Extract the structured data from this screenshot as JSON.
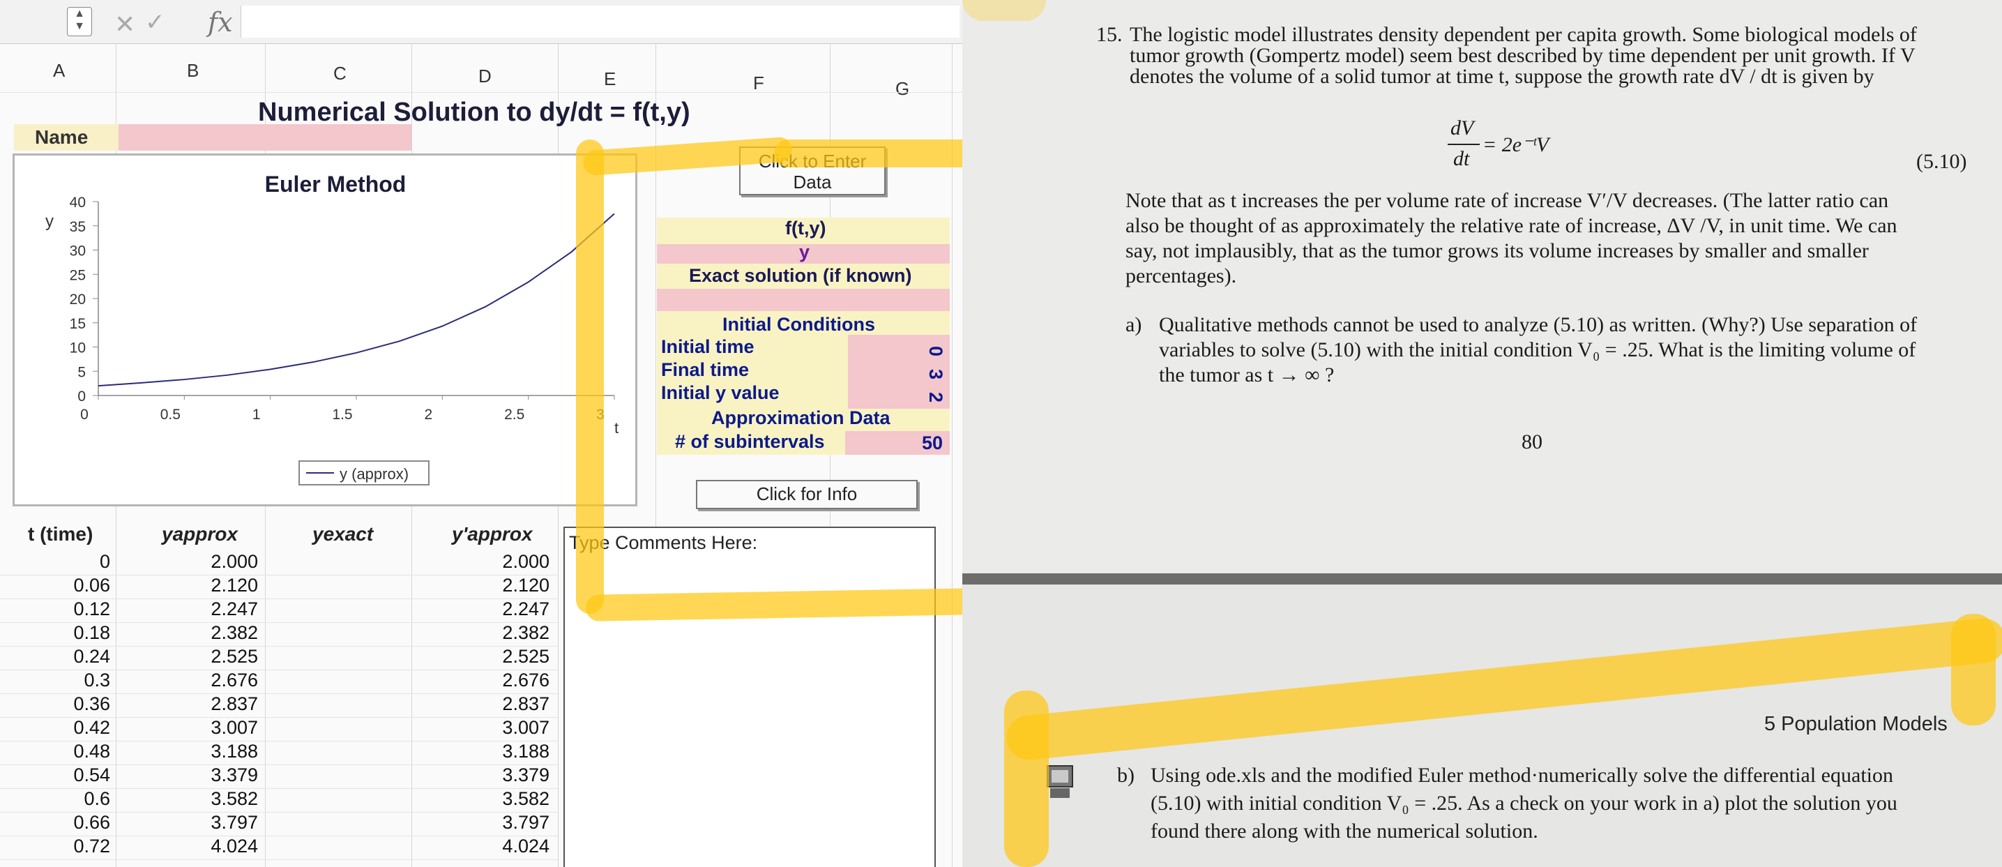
{
  "formula_bar": {
    "cancel_glyph": "✕",
    "enter_glyph": "✓",
    "fx_label": "fx"
  },
  "columns": [
    "A",
    "B",
    "C",
    "D",
    "E",
    "F",
    "G"
  ],
  "sheet": {
    "title": "Numerical Solution to  dy/dt = f(t,y)",
    "name_label": "Name",
    "enter_data_button": "Click to Enter Data",
    "ft_label": "f(t,y)",
    "y_label": "y",
    "exact_label": "Exact solution (if known)",
    "init_conditions_label": "Initial Conditions",
    "initial_time_label": "Initial time",
    "final_time_label": "Final time",
    "initial_y_label": "Initial y value",
    "approx_data_label": "Approximation Data",
    "subintervals_label": "# of subintervals",
    "initial_time_value": "0",
    "final_time_value": "3",
    "initial_y_value": "2",
    "subintervals_value": "50",
    "info_button": "Click for Info",
    "comments_label": "Type Comments Here:"
  },
  "chart_data": {
    "type": "line",
    "title": "Euler Method",
    "ylabel": "y",
    "xlabel": "t",
    "xlim": [
      0,
      3
    ],
    "ylim": [
      0,
      40
    ],
    "x_ticks": [
      "0",
      "0.5",
      "1",
      "1.5",
      "2",
      "2.5",
      "3"
    ],
    "y_ticks": [
      "0",
      "5",
      "10",
      "15",
      "20",
      "25",
      "30",
      "35",
      "40"
    ],
    "legend": "y (approx)",
    "series": [
      {
        "name": "y (approx)",
        "color": "#2b2b7a",
        "x": [
          0,
          0.25,
          0.5,
          0.75,
          1.0,
          1.25,
          1.5,
          1.75,
          2.0,
          2.25,
          2.5,
          2.75,
          3.0
        ],
        "y": [
          2.0,
          2.6,
          3.3,
          4.2,
          5.4,
          6.9,
          8.8,
          11.2,
          14.3,
          18.3,
          23.4,
          29.6,
          37.5
        ]
      }
    ]
  },
  "table": {
    "headers": {
      "t": "t (time)",
      "yapprox": "yapprox",
      "yexact": "yexact",
      "ypapprox": "y'approx"
    },
    "rows": [
      {
        "t": "0",
        "yapprox": "2.000",
        "ypapprox": "2.000"
      },
      {
        "t": "0.06",
        "yapprox": "2.120",
        "ypapprox": "2.120"
      },
      {
        "t": "0.12",
        "yapprox": "2.247",
        "ypapprox": "2.247"
      },
      {
        "t": "0.18",
        "yapprox": "2.382",
        "ypapprox": "2.382"
      },
      {
        "t": "0.24",
        "yapprox": "2.525",
        "ypapprox": "2.525"
      },
      {
        "t": "0.3",
        "yapprox": "2.676",
        "ypapprox": "2.676"
      },
      {
        "t": "0.36",
        "yapprox": "2.837",
        "ypapprox": "2.837"
      },
      {
        "t": "0.42",
        "yapprox": "3.007",
        "ypapprox": "3.007"
      },
      {
        "t": "0.48",
        "yapprox": "3.188",
        "ypapprox": "3.188"
      },
      {
        "t": "0.54",
        "yapprox": "3.379",
        "ypapprox": "3.379"
      },
      {
        "t": "0.6",
        "yapprox": "3.582",
        "ypapprox": "3.582"
      },
      {
        "t": "0.66",
        "yapprox": "3.797",
        "ypapprox": "3.797"
      },
      {
        "t": "0.72",
        "yapprox": "4.024",
        "ypapprox": "4.024"
      }
    ]
  },
  "book": {
    "problem_number": "15.",
    "para1_line1": "The logistic model illustrates density dependent per capita growth.  Some biological models of",
    "para1_line2": "tumor growth (Gompertz model) seem best described by time dependent per unit growth.  If V",
    "para1_line3": "denotes the volume of a solid tumor at time t, suppose the growth rate dV / dt is given by",
    "equation_lhs_num": "dV",
    "equation_lhs_den": "dt",
    "equation_rhs": "= 2e⁻ᵗV",
    "equation_number": "(5.10)",
    "para2_line1": "Note that as t increases the per volume rate of increase V′/V decreases.  (The latter ratio can",
    "para2_line2": "also be thought of as approximately the relative rate of increase, ΔV /V, in unit time.  We can",
    "para2_line3": "say, not implausibly, that as the tumor grows its volume increases by smaller and smaller",
    "para2_line4": "percentages).",
    "part_a_label": "a)",
    "part_a_line1": "Qualitative methods cannot be used to analyze (5.10) as written. (Why?)  Use separation of",
    "part_a_line2": "variables to solve (5.10) with the initial condition V₀ = .25.  What is the limiting volume of",
    "part_a_line3": "the tumor as t → ∞ ?",
    "page_number": "80",
    "running_head": "5 Population Models",
    "part_b_label": "b)",
    "part_b_line1": "Using ode.xls and the modified Euler method·numerically solve the differential equation",
    "part_b_line2": "(5.10) with initial condition V₀ = .25.  As a check on your work in a) plot the solution you",
    "part_b_line3": "found there along with the numerical solution."
  }
}
